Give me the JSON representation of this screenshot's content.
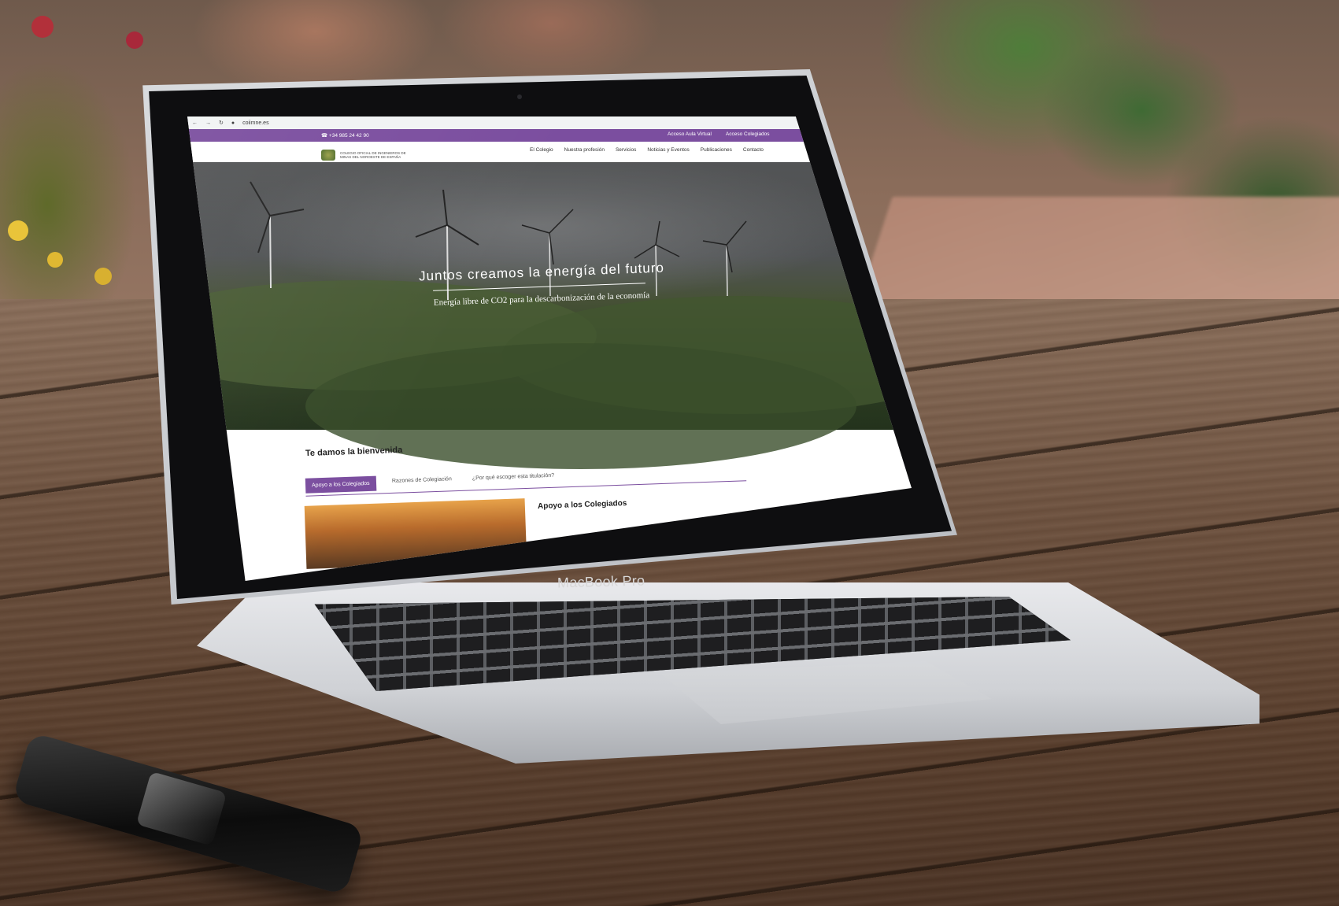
{
  "browser": {
    "url": "coiimne.es"
  },
  "topbar": {
    "phone": "+34 985 24 42 90",
    "links": [
      "Acceso Aula Virtual",
      "Acceso Colegiados"
    ]
  },
  "logo": {
    "text": "COLEGIO OFICIAL DE INGENIEROS DE MINAS DEL NOROESTE DE ESPAÑA"
  },
  "nav": {
    "items": [
      "El Colegio",
      "Nuestra profesión",
      "Servicios",
      "Noticias y Eventos",
      "Publicaciones",
      "Contacto"
    ]
  },
  "hero": {
    "title": "Juntos creamos la energía del futuro",
    "subtitle": "Energía libre de CO2 para la descarbonización de la economía"
  },
  "welcome": {
    "title": "Te damos la bienvenida"
  },
  "tabs": [
    "Apoyo a los Colegiados",
    "Razones de Colegiación",
    "¿Por qué escoger esta titulación?"
  ],
  "content": {
    "title": "Apoyo a los Colegiados"
  },
  "device": {
    "label": "MacBook Pro"
  },
  "colors": {
    "brand": "#7b4e9f"
  }
}
